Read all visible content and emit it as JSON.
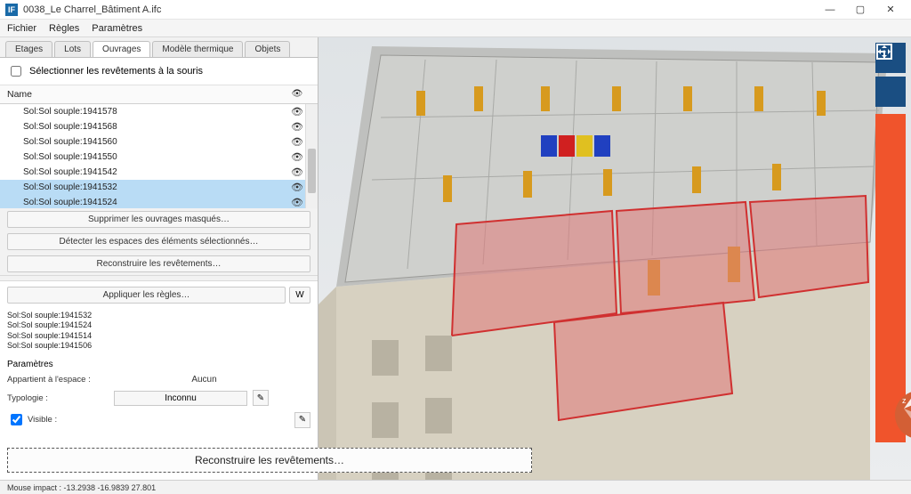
{
  "window": {
    "title": "0038_Le Charrel_Bâtiment A.ifc",
    "appicon_letter": "IF"
  },
  "menu": {
    "items": [
      "Fichier",
      "Règles",
      "Paramètres"
    ]
  },
  "tabs": {
    "items": [
      "Etages",
      "Lots",
      "Ouvrages",
      "Modèle thermique",
      "Objets"
    ],
    "active_index": 2
  },
  "mouse_select": {
    "label": "Sélectionner les revêtements à la souris",
    "checked": false
  },
  "list": {
    "header_name": "Name",
    "header_vis": "👁",
    "rows": [
      {
        "name": "Sol:Sol souple:1941578",
        "selected": false
      },
      {
        "name": "Sol:Sol souple:1941568",
        "selected": false
      },
      {
        "name": "Sol:Sol souple:1941560",
        "selected": false
      },
      {
        "name": "Sol:Sol souple:1941550",
        "selected": false
      },
      {
        "name": "Sol:Sol souple:1941542",
        "selected": false
      },
      {
        "name": "Sol:Sol souple:1941532",
        "selected": true
      },
      {
        "name": "Sol:Sol souple:1941524",
        "selected": true
      },
      {
        "name": "Sol:Sol souple:1941514",
        "selected": true
      },
      {
        "name": "Sol:Sol souple:1941506",
        "selected": true
      }
    ]
  },
  "action_buttons": {
    "delete_masked": "Supprimer les ouvrages masqués…",
    "detect_spaces": "Détecter les espaces des éléments sélectionnés…",
    "rebuild_coverings": "Reconstruire les revêtements…"
  },
  "rules": {
    "apply": "Appliquer les règles…",
    "w": "W"
  },
  "selection_list": [
    "Sol:Sol souple:1941532",
    "Sol:Sol souple:1941524",
    "Sol:Sol souple:1941514",
    "Sol:Sol souple:1941506"
  ],
  "params": {
    "heading": "Paramètres",
    "belongs_label": "Appartient à l'espace :",
    "belongs_value": "Aucun",
    "typology_label": "Typologie :",
    "typology_value": "Inconnu",
    "visible_label": "Visible :",
    "visible_checked": true,
    "edit_icon": "✎"
  },
  "big_button": "Reconstruire les revêtements…",
  "status": "Mouse impact : -13.2938 -16.9839 27.801",
  "viewport": {
    "tool1": "plan-icon",
    "tool2": "fit-view-icon"
  },
  "colors": {
    "selection_fill": "#e49b9b",
    "selection_stroke": "#d03030",
    "door": "#d79a1e",
    "wall": "#c9cbc9",
    "floor": "#b7b8b6",
    "facade1": "#d9d2c1",
    "facade2": "#cfc9b9",
    "toolbar": "#1a4e82",
    "toolbar_accent": "#f0542c"
  }
}
